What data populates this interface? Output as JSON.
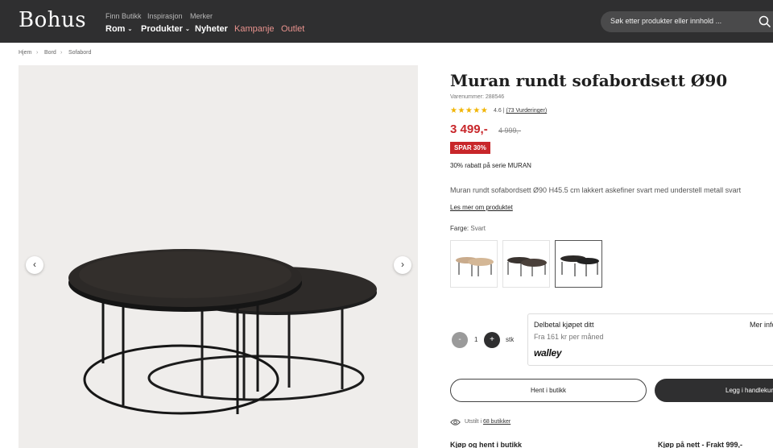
{
  "header": {
    "logo": "Bohus",
    "top_links": [
      "Finn Butikk",
      "Inspirasjon",
      "Merker"
    ],
    "main_links": [
      {
        "label": "Rom",
        "dropdown": true
      },
      {
        "label": "Produkter",
        "dropdown": true
      },
      {
        "label": "Nyheter",
        "dropdown": false
      },
      {
        "label": "Kampanje",
        "dropdown": false
      },
      {
        "label": "Outlet",
        "dropdown": false
      }
    ],
    "caret": "⌄",
    "search_placeholder": "Søk etter produkter eller innhold ..."
  },
  "breadcrumb": [
    "Hjem",
    "Bord",
    "Sofabord"
  ],
  "breadcrumb_sep": "›",
  "gallery": {
    "prev_arrow": "‹",
    "next_arrow": "›"
  },
  "product": {
    "title": "Muran rundt sofabordsett Ø90",
    "sku": "Varenummer: 288546",
    "stars": "★★★★★",
    "rating_value": "4.6",
    "rating_sep": " | ",
    "rating_count": "(73 Vurderinger)",
    "price": "3 499,-",
    "old_price": "4 999,-",
    "badge": "SPAR 30%",
    "promo": "30% rabatt på serie MURAN",
    "description": "Muran rundt sofabordsett Ø90 H45.5 cm lakkert askefiner svart med understell metall svart",
    "read_more": "Les mer om produktet",
    "color_label": "Farge:",
    "color_value": "Svart",
    "swatches": [
      "Eik",
      "Røkt",
      "Svart"
    ],
    "selected_swatch": 2
  },
  "quantity": {
    "minus": "-",
    "value": "1",
    "plus": "+",
    "unit": "stk"
  },
  "walley": {
    "title": "Delbetal kjøpet ditt",
    "more": "Mer info",
    "subtitle": "Fra 161 kr per måned",
    "logo": "walley"
  },
  "buttons": {
    "pickup": "Hent i butikk",
    "add_to_cart": "Legg i handlekurv"
  },
  "stock": {
    "prefix": "Utstilt i ",
    "link": "68 butikker"
  },
  "footer_info": {
    "left": "Kjøp og hent i butikk",
    "right": "Kjøp på nett - Frakt 999,-"
  },
  "colors": {
    "header_bg": "#2f2f30",
    "price_red": "#c8262a",
    "star": "#f1b400",
    "campaign": "#e9938e"
  }
}
